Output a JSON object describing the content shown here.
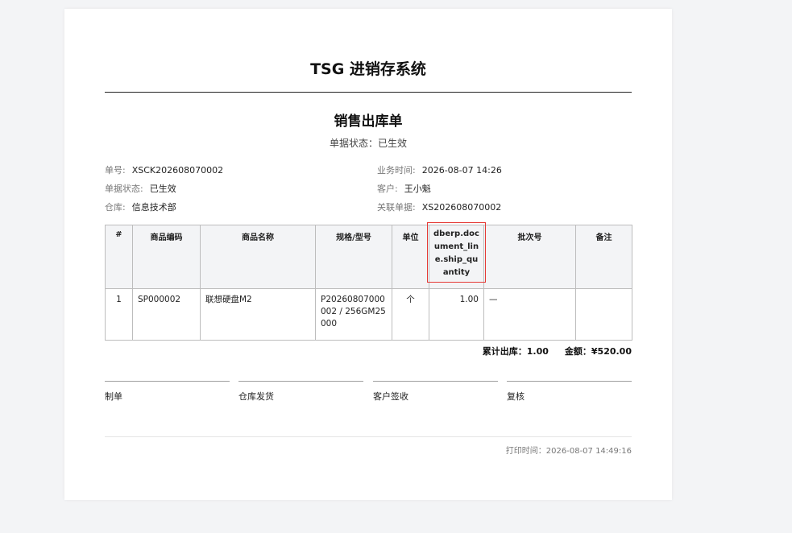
{
  "system_title": "TSG 进销存系统",
  "document": {
    "title": "销售出库单",
    "status_line": "单据状态：已生效"
  },
  "info": {
    "order_no": {
      "label": "单号:",
      "value": "XSCK202608070002"
    },
    "business_time": {
      "label": "业务时间:",
      "value": "2026-08-07 14:26"
    },
    "doc_status": {
      "label": "单据状态:",
      "value": "已生效"
    },
    "customer": {
      "label": "客户:",
      "value": "王小魁"
    },
    "warehouse": {
      "label": "仓库:",
      "value": "信息技术部"
    },
    "related_doc": {
      "label": "关联单据:",
      "value": "XS202608070002"
    }
  },
  "table": {
    "headers": [
      "#",
      "商品编码",
      "商品名称",
      "规格/型号",
      "单位",
      "dberp.document_line.ship_quantity",
      "批次号",
      "备注"
    ],
    "rows": [
      [
        "1",
        "SP000002",
        "联想硬盘M2",
        "P20260807000002 / 256GM25000",
        "个",
        "1.00",
        "—",
        ""
      ]
    ]
  },
  "summary": {
    "total_out": "累计出库：1.00",
    "amount": "金额：¥520.00"
  },
  "signatures": [
    "制单",
    "仓库发货",
    "客户签收",
    "复核"
  ],
  "print_time": "打印时间：2026-08-07 14:49:16",
  "colors": {
    "highlight_border": "#e53935",
    "header_bg": "#f3f4f6",
    "page_bg": "#f3f4f6"
  }
}
